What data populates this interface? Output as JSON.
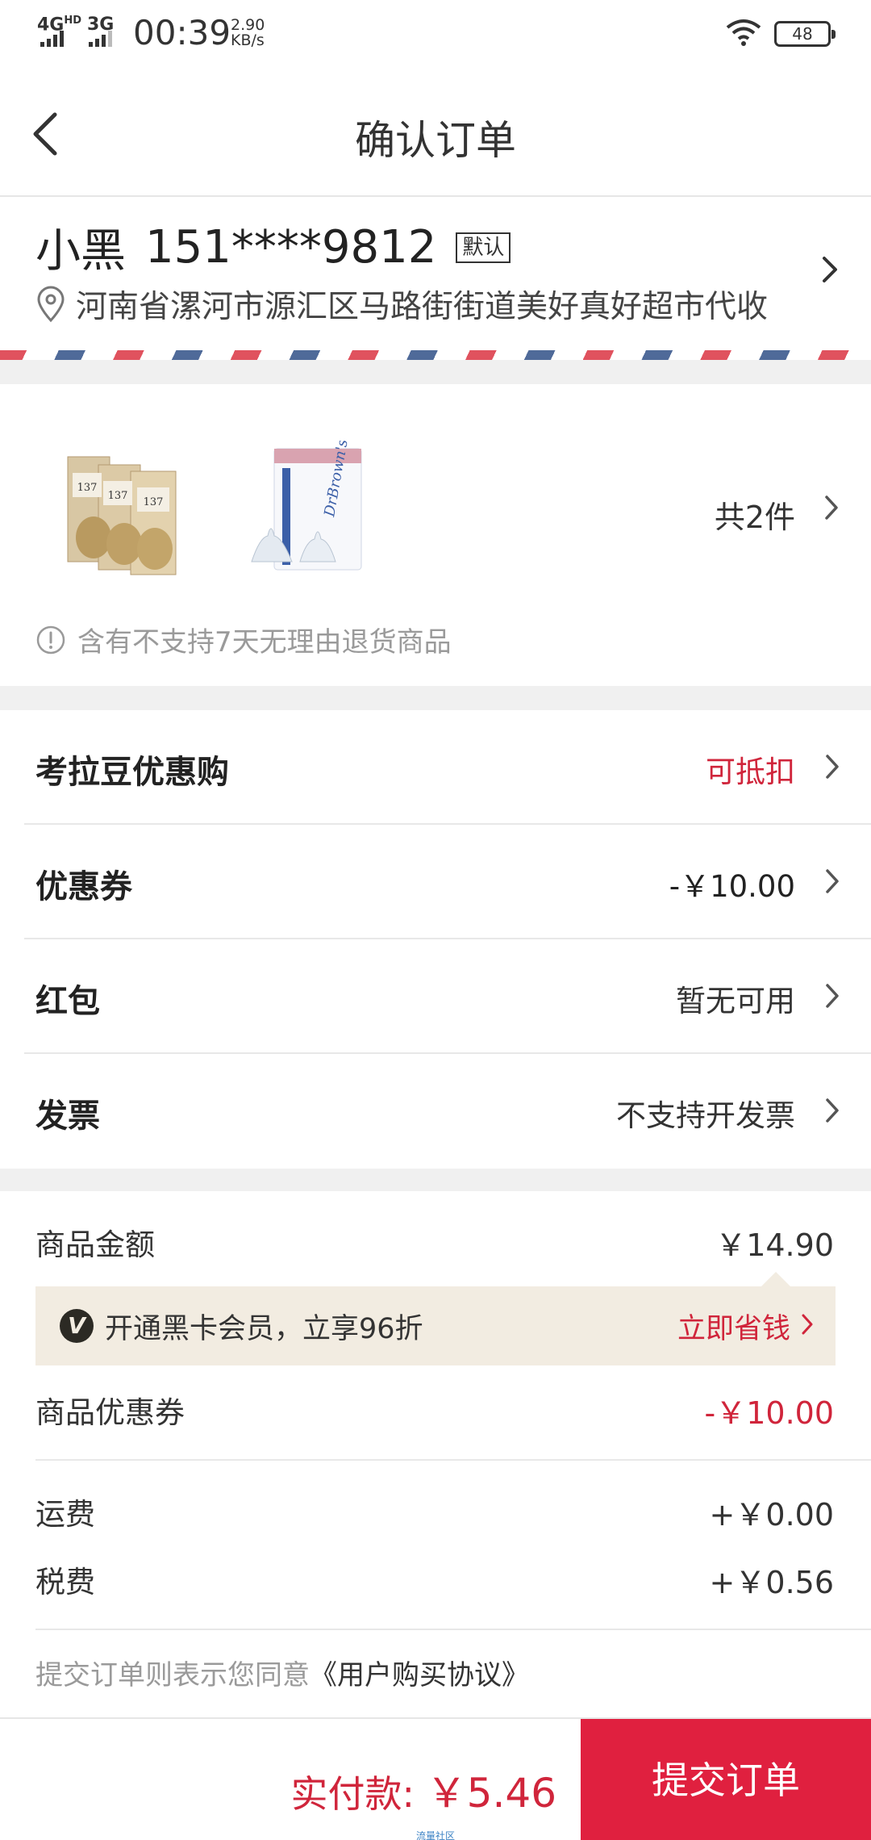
{
  "status_bar": {
    "network_1": "4G",
    "network_1_sup": "HD",
    "network_2": "3G",
    "time": "00:39",
    "speed_value": "2.90",
    "speed_unit": "KB/s",
    "battery": "48"
  },
  "header": {
    "title": "确认订单"
  },
  "address": {
    "name": "小黑",
    "phone": "151****9812",
    "default_tag": "默认",
    "detail": "河南省漯河市源汇区马路街街道美好真好超市代收"
  },
  "products": {
    "count_label": "共2件",
    "notice": "含有不支持7天无理由退货商品",
    "items": [
      {
        "name": "pistachio milk",
        "brand_text": "137 degrees"
      },
      {
        "name": "Dr.Brown's nipples",
        "brand_text": "Dr.Brown's"
      }
    ]
  },
  "options": [
    {
      "label": "考拉豆优惠购",
      "value": "可抵扣",
      "value_color": "#d0253b"
    },
    {
      "label": "优惠券",
      "value": "-￥10.00",
      "value_color": "#222222"
    },
    {
      "label": "红包",
      "value": "暂无可用",
      "value_color": "#333333"
    },
    {
      "label": "发票",
      "value": "不支持开发票",
      "value_color": "#333333"
    }
  ],
  "summary": {
    "goods_amount_label": "商品金额",
    "goods_amount_value": "￥14.90",
    "vip_badge": "V",
    "vip_text": "开通黑卡会员，立享96折",
    "vip_action": "立即省钱",
    "coupon_label": "商品优惠券",
    "coupon_value": "-￥10.00",
    "shipping_label": "运费",
    "shipping_value": "+￥0.00",
    "tax_label": "税费",
    "tax_value": "+￥0.56"
  },
  "agreement": {
    "prefix": "提交订单则表示您同意",
    "link": "《用户购买协议》"
  },
  "footer": {
    "total_label": "实付款: ",
    "total_value": "￥5.46",
    "submit": "提交订单",
    "watermark": "流量社区"
  },
  "colors": {
    "accent": "#e0203f",
    "price_red": "#d0253b",
    "vip_bg": "#f2ece1"
  }
}
